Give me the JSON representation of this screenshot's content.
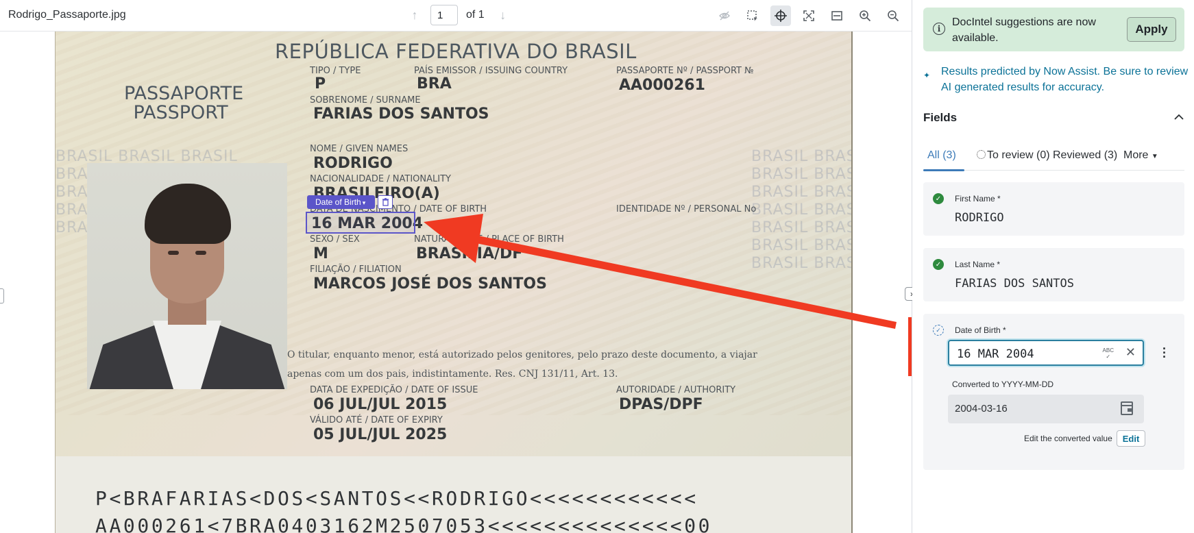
{
  "viewer": {
    "file_name": "Rodrigo_Passaporte.jpg",
    "page_value": "1",
    "page_total": "of 1"
  },
  "icons": {
    "prev_page": "arrow-up-icon",
    "next_page": "arrow-down-icon",
    "hide": "eye-off-icon",
    "select": "selection-icon",
    "pan": "crosshair-icon",
    "fit": "fit-screen-icon",
    "fit_width": "fit-width-icon",
    "zoom_in": "zoom-in-icon",
    "zoom_out": "zoom-out-icon"
  },
  "passport": {
    "title": "REPÚBLICA FEDERATIVA DO BRASIL",
    "word_pt": "PASSAPORTE",
    "word_en": "PASSPORT",
    "type_label": "TIPO / TYPE",
    "type_value": "P",
    "country_label": "PAÍS EMISSOR / ISSUING COUNTRY",
    "country_value": "BRA",
    "passport_no_label": "PASSAPORTE Nº / PASSPORT №",
    "passport_no_value": "AA000261",
    "surname_label": "SOBRENOME / SURNAME",
    "surname_value": "FARIAS DOS SANTOS",
    "given_label": "NOME / GIVEN NAMES",
    "given_value": "RODRIGO",
    "nationality_label": "NACIONALIDADE / NATIONALITY",
    "nationality_value": "BRASILEIRO(A)",
    "dob_label": "DATA DE NASCIMENTO / DATE OF BIRTH",
    "dob_value": "16 MAR 2004",
    "personal_no_label": "IDENTIDADE Nº / PERSONAL No",
    "sex_label": "SEXO / SEX",
    "sex_value": "M",
    "pob_label": "NATURALIDADE / PLACE OF BIRTH",
    "pob_value": "BRASÍLIA/DF",
    "filiation_label": "FILIAÇÃO / FILIATION",
    "filiation_value": "MARCOS JOSÉ DOS SANTOS",
    "note_line1": "O titular, enquanto menor, está autorizado pelos genitores, pelo prazo deste documento, a viajar",
    "note_line2": "apenas com um dos pais, indistintamente. Res. CNJ 131/11, Art. 13.",
    "issue_label": "DATA DE EXPEDIÇÃO / DATE OF ISSUE",
    "issue_value": "06 JUL/JUL 2015",
    "authority_label": "AUTORIDADE / AUTHORITY",
    "authority_value": "DPAS/DPF",
    "expiry_label": "VÁLIDO ATÉ / DATE OF EXPIRY",
    "expiry_value": "05 JUL/JUL 2025",
    "mrz1": "P<BRAFARIAS<DOS<SANTOS<<RODRIGO<<<<<<<<<<<<",
    "mrz2": "AA000261<7BRA0403162M2507053<<<<<<<<<<<<<<00",
    "watermark": "BRASIL BRASIL BRASIL"
  },
  "detection": {
    "tag_label": "Date of Birth",
    "caret": "▾",
    "trash_icon": "trash-icon"
  },
  "panel": {
    "banner_text": "DocIntel suggestions are now available.",
    "apply_label": "Apply",
    "ai_note": "Results predicted by Now Assist. Be sure to review AI generated results for accuracy.",
    "fields_title": "Fields",
    "tabs": {
      "all": "All (3)",
      "to_review": "To review (0)",
      "reviewed": "Reviewed (3)",
      "more": "More"
    },
    "first_name": {
      "label": "First Name *",
      "value": "RODRIGO"
    },
    "last_name": {
      "label": "Last Name *",
      "value": "FARIAS DOS SANTOS"
    },
    "dob": {
      "label": "Date of Birth *",
      "value": "16 MAR 2004"
    },
    "converted_label": "Converted to YYYY-MM-DD",
    "converted_value": "2004-03-16",
    "edit_label": "Edit the converted value",
    "edit_button": "Edit"
  },
  "colors": {
    "accent": "#3d7bb8",
    "highlight": "#5b55c9",
    "annotation_red": "#f03a22",
    "banner": "#d5ecda",
    "success": "#2e8a3e"
  }
}
